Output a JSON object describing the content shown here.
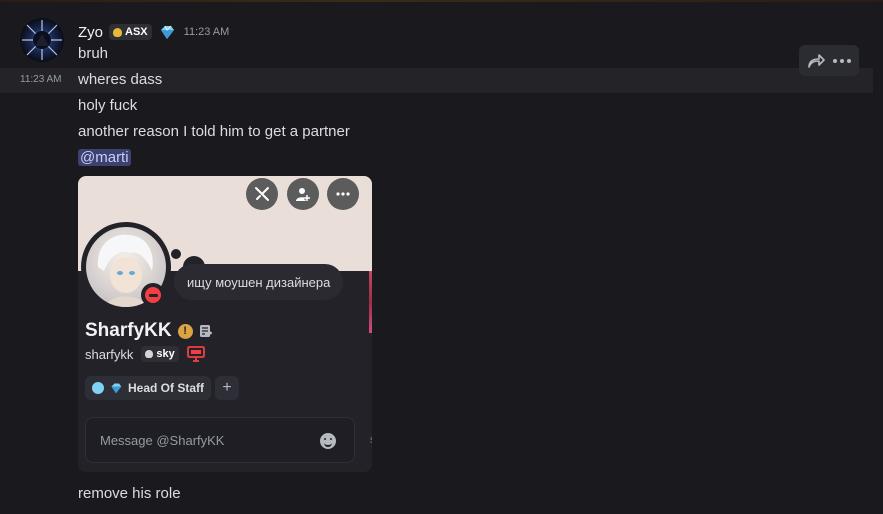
{
  "message": {
    "author": "Zyo",
    "guild_tag": "ASX",
    "time": "11:23 AM",
    "side_time": "11:23 AM",
    "lines": [
      "bruh",
      "wheres dass",
      "holy fuck",
      "another reason I told him to get a partner"
    ],
    "mention": "@marti",
    "last_line": "remove his role"
  },
  "actions": {
    "forward_icon": "forward-icon",
    "more_icon": "more-icon"
  },
  "profile_card": {
    "status_text": "ищу моушен дизайнера",
    "display_name": "SharfyKK",
    "username": "sharfykk",
    "tag": "sky",
    "role": "Head Of Staff",
    "plus": "+",
    "message_placeholder": "Message @SharfyKK",
    "side_fragment": "s",
    "colors": {
      "banner": "#e9ded8",
      "status": "#f23f43",
      "role_dot": "#7fd3f4",
      "mention_bg": "#3c4170"
    }
  }
}
